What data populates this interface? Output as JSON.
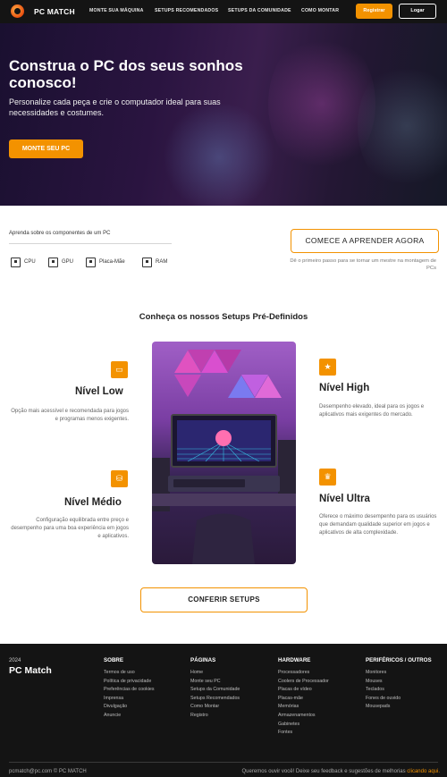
{
  "header": {
    "brand": "PC MATCH",
    "nav": [
      "MONTE SUA MÁQUINA",
      "SETUPS RECOMENDADOS",
      "SETUPS DA COMUNIDADE",
      "COMO MONTAR"
    ],
    "register": "Registrar",
    "login": "Logar"
  },
  "hero": {
    "title": "Construa o PC dos seus sonhos conosco!",
    "subtitle": "Personalize cada peça e crie o computador ideal para suas necessidades e costumes.",
    "cta": "MONTE SEU PC"
  },
  "learn": {
    "label": "Aprenda sobre os componentes de um PC",
    "components": [
      {
        "label": "CPU",
        "icon": "cpu-icon"
      },
      {
        "label": "GPU",
        "icon": "gpu-icon"
      },
      {
        "label": "Placa-Mãe",
        "icon": "motherboard-icon"
      },
      {
        "label": "RAM",
        "icon": "ram-icon"
      }
    ],
    "button": "COMECE A APRENDER AGORA",
    "note": "Dê o primeiro passo para se tornar um mestre na montagem de PCs"
  },
  "setups": {
    "title": "Conheça os nossos Setups Pré-Definidos",
    "tiers": [
      {
        "name": "Nível Low",
        "desc": "Opção mais acessível e recomendada para jogos e programas menos exigentes.",
        "icon": "battery-icon"
      },
      {
        "name": "Nível Médio",
        "desc": "Configuração equilibrada entre preço e desempenho para uma boa experiência em jogos e aplicativos.",
        "icon": "database-icon"
      },
      {
        "name": "Nível High",
        "desc": "Desempenho elevado, ideal para os jogos e aplicativos mais exigentes do mercado.",
        "icon": "star-icon"
      },
      {
        "name": "Nível Ultra",
        "desc": "Oferece o máximo desempenho para os usuários que demandam qualidade superior em jogos e aplicativos de alta complexidade.",
        "icon": "trophy-icon"
      }
    ],
    "button": "CONFERIR SETUPS"
  },
  "footer": {
    "year": "2024",
    "brand": "PC Match",
    "columns": [
      {
        "title": "SOBRE",
        "items": [
          "Termos de uso",
          "Política de privacidade",
          "Preferências de cookies",
          "Imprensa",
          "Divulgação",
          "Anuncie"
        ]
      },
      {
        "title": "PÁGINAS",
        "items": [
          "Home",
          "Monte seu PC",
          "Setups da Comunidade",
          "Setups Recomendados",
          "Como Montar",
          "Registro"
        ]
      },
      {
        "title": "HARDWARE",
        "items": [
          "Processadores",
          "Coolers de Processador",
          "Placas de vídeo",
          "Placas-mãe",
          "Memórias",
          "Armazenamentos",
          "Gabinetes",
          "Fontes"
        ]
      },
      {
        "title": "PERIFÉRICOS / OUTROS",
        "items": [
          "Monitores",
          "Mouses",
          "Teclados",
          "Fones de ouvido",
          "Mousepads"
        ]
      }
    ],
    "copyright": "pcmatch@pc.com © PC MATCH",
    "feedback_text": "Queremos ouvir você! Deixe seu feedback e sugestões de melhorias",
    "feedback_link": "clicando aqui."
  },
  "colors": {
    "accent": "#f39200",
    "dark": "#141414"
  }
}
